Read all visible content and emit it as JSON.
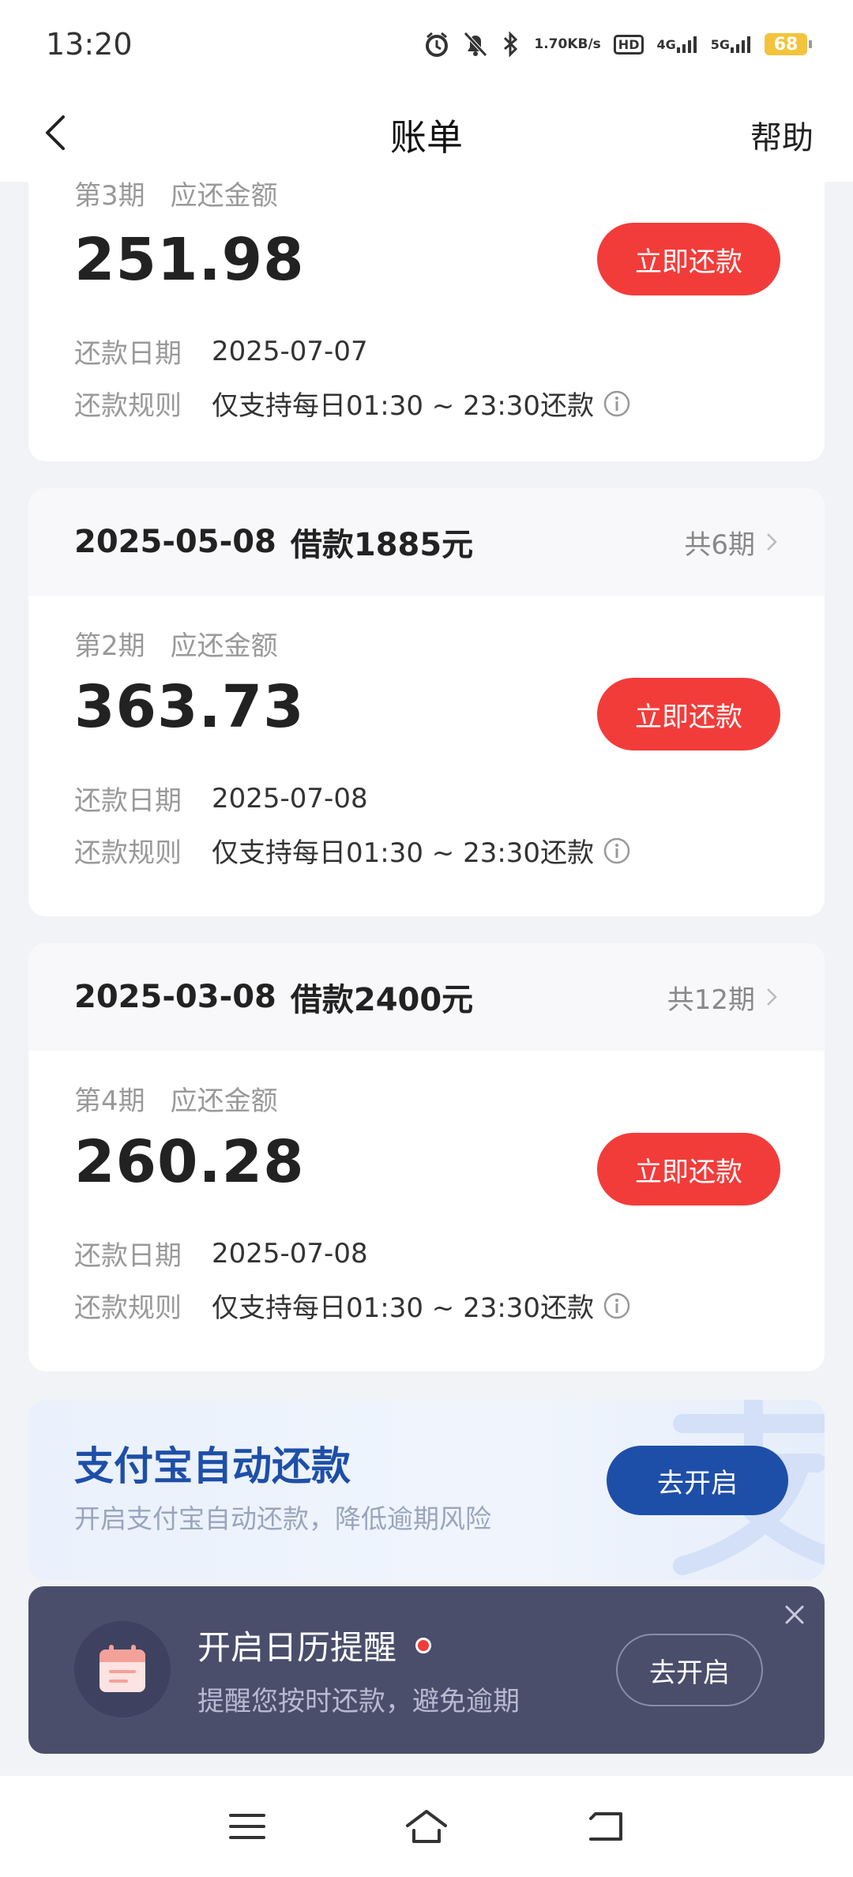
{
  "status_bar": {
    "time": "13:20",
    "speed_top": "1.70",
    "speed_bottom": "KB/s",
    "hd_label": "HD",
    "net1": "4G",
    "net2": "5G",
    "battery": "68"
  },
  "header": {
    "title": "账单",
    "help": "帮助"
  },
  "bills": [
    {
      "loan_date": "",
      "loan_amount": "",
      "periods": "",
      "period_label": "第3期",
      "due_label": "应还金额",
      "amount": "251.98",
      "pay_button": "立即还款",
      "date_label": "还款日期",
      "date_value": "2025-07-07",
      "rule_label": "还款规则",
      "rule_value": "仅支持每日01:30 ~ 23:30还款"
    },
    {
      "loan_date": "2025-05-08",
      "loan_amount": "借款1885元",
      "periods": "共6期",
      "period_label": "第2期",
      "due_label": "应还金额",
      "amount": "363.73",
      "pay_button": "立即还款",
      "date_label": "还款日期",
      "date_value": "2025-07-08",
      "rule_label": "还款规则",
      "rule_value": "仅支持每日01:30 ~ 23:30还款"
    },
    {
      "loan_date": "2025-03-08",
      "loan_amount": "借款2400元",
      "periods": "共12期",
      "period_label": "第4期",
      "due_label": "应还金额",
      "amount": "260.28",
      "pay_button": "立即还款",
      "date_label": "还款日期",
      "date_value": "2025-07-08",
      "rule_label": "还款规则",
      "rule_value": "仅支持每日01:30 ~ 23:30还款"
    }
  ],
  "alipay_banner": {
    "title": "支付宝自动还款",
    "subtitle": "开启支付宝自动还款，降低逾期风险",
    "button": "去开启"
  },
  "calendar_reminder": {
    "title": "开启日历提醒",
    "subtitle": "提醒您按时还款，避免逾期",
    "button": "去开启"
  },
  "colors": {
    "accent_red": "#f23c3a",
    "alipay_blue": "#1e4fa8",
    "reminder_bg": "#4a4e6b"
  }
}
